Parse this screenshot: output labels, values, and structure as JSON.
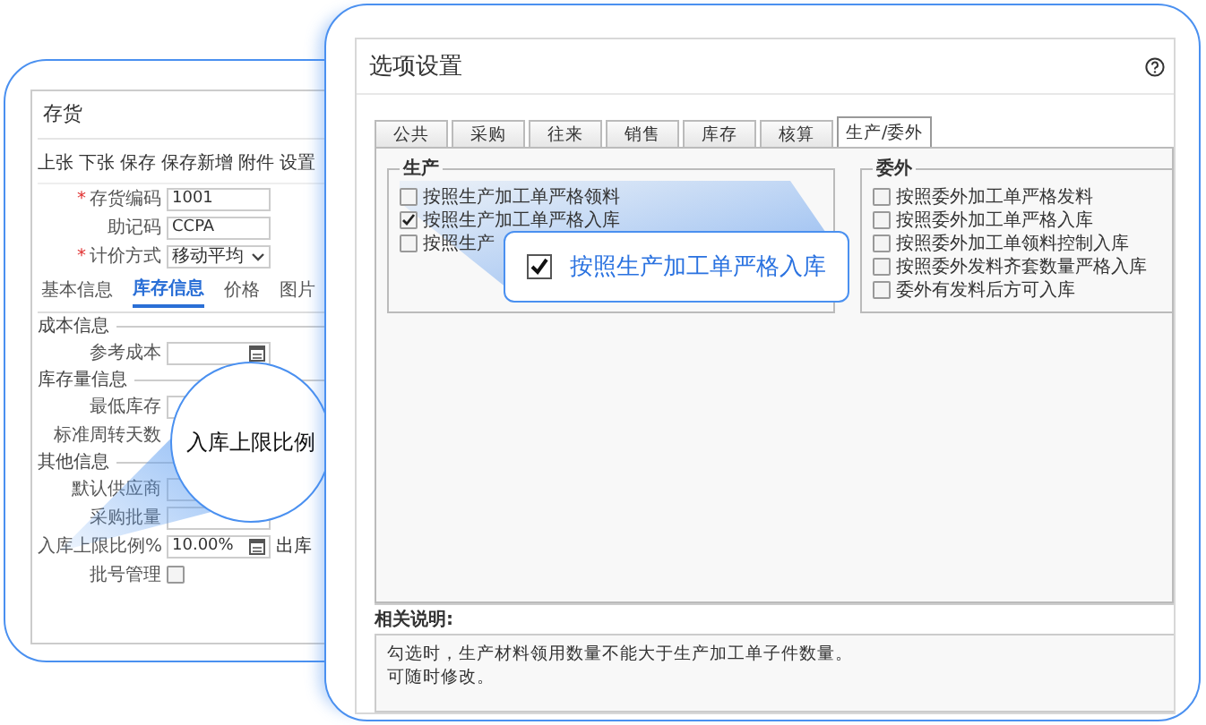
{
  "inventory_window": {
    "title": "存货",
    "toolbar": [
      "上张",
      "下张",
      "保存",
      "保存新增",
      "附件",
      "设置"
    ],
    "fields": [
      {
        "label": "存货编码",
        "mark": "*",
        "kind": "text",
        "value": "1001"
      },
      {
        "label": "助记码",
        "kind": "text",
        "value": "CCPA"
      },
      {
        "label": "计价方式",
        "mark": "*",
        "kind": "select",
        "value": "移动平均"
      }
    ],
    "tabs": [
      {
        "label": "基本信息",
        "selected": false
      },
      {
        "label": "库存信息",
        "selected": true
      },
      {
        "label": "价格",
        "selected": false
      },
      {
        "label": "图片",
        "selected": false
      }
    ],
    "sections": [
      {
        "title": "成本信息",
        "rows": [
          {
            "label": "参考成本",
            "kind": "picker"
          }
        ]
      },
      {
        "title": "库存量信息",
        "rows": [
          {
            "label": "最低库存",
            "kind": "input"
          },
          {
            "label": "标准周转天数",
            "kind": "label"
          }
        ]
      },
      {
        "title": "其他信息",
        "rows": [
          {
            "label": "默认供应商",
            "kind": "input"
          },
          {
            "label": "采购批量",
            "kind": "input"
          },
          {
            "label": "入库上限比例%",
            "kind": "picker",
            "value": "10.00%",
            "side_label": "出库"
          },
          {
            "label": "批号管理",
            "kind": "checkbox",
            "checked": false
          }
        ]
      }
    ]
  },
  "magnifier": {
    "text": "入库上限比例"
  },
  "options_window": {
    "title": "选项设置",
    "tabs": [
      {
        "label": "公共",
        "selected": false
      },
      {
        "label": "采购",
        "selected": false
      },
      {
        "label": "往来",
        "selected": false
      },
      {
        "label": "销售",
        "selected": false
      },
      {
        "label": "库存",
        "selected": false
      },
      {
        "label": "核算",
        "selected": false
      },
      {
        "label": "生产/委外",
        "selected": true
      }
    ],
    "groups": [
      {
        "title": "生产",
        "items": [
          {
            "label": "按照生产加工单严格领料",
            "checked": false
          },
          {
            "label": "按照生产加工单严格入库",
            "checked": true
          },
          {
            "label": "按照生产",
            "checked": false
          }
        ]
      },
      {
        "title": "委外",
        "items": [
          {
            "label": "按照委外加工单严格发料",
            "checked": false
          },
          {
            "label": "按照委外加工单严格入库",
            "checked": false
          },
          {
            "label": "按照委外加工单领料控制入库",
            "checked": false
          },
          {
            "label": "按照委外发料齐套数量严格入库",
            "checked": false
          },
          {
            "label": "委外有发料后方可入库",
            "checked": false
          }
        ]
      }
    ],
    "callout": {
      "label": "按照生产加工单严格入库",
      "checked": true
    },
    "notes_title": "相关说明:",
    "notes": [
      "勾选时，生产材料领用数量不能大于生产加工单子件数量。",
      "可随时修改。"
    ]
  }
}
